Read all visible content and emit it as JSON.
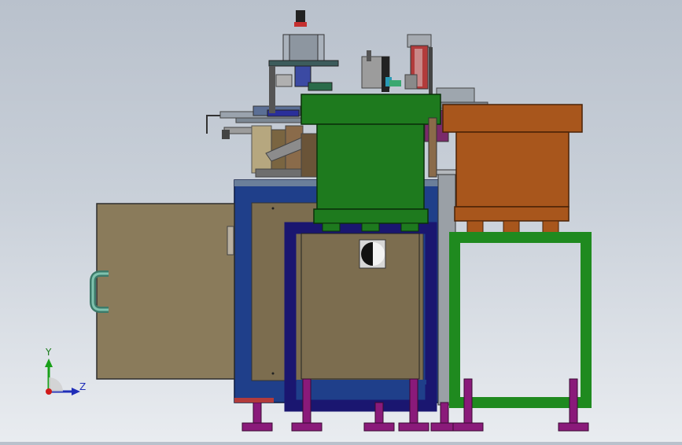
{
  "viewport": {
    "background_top": "#b9c1cc",
    "background_bottom": "#e9ecf0"
  },
  "triad": {
    "y_label": "Y",
    "z_label": "Z",
    "y_color": "#19a019",
    "z_color": "#1f2db8",
    "x_color": "#d01a1a"
  },
  "colors": {
    "frame_blue": "#1f3f8a",
    "frame_navy": "#1a1670",
    "tank_green": "#1e7a1e",
    "hopper_orange": "#a8561c",
    "panel_tan": "#8a7b5b",
    "stand_green": "#1f8a1f",
    "foot_magenta": "#8a1a7a"
  }
}
